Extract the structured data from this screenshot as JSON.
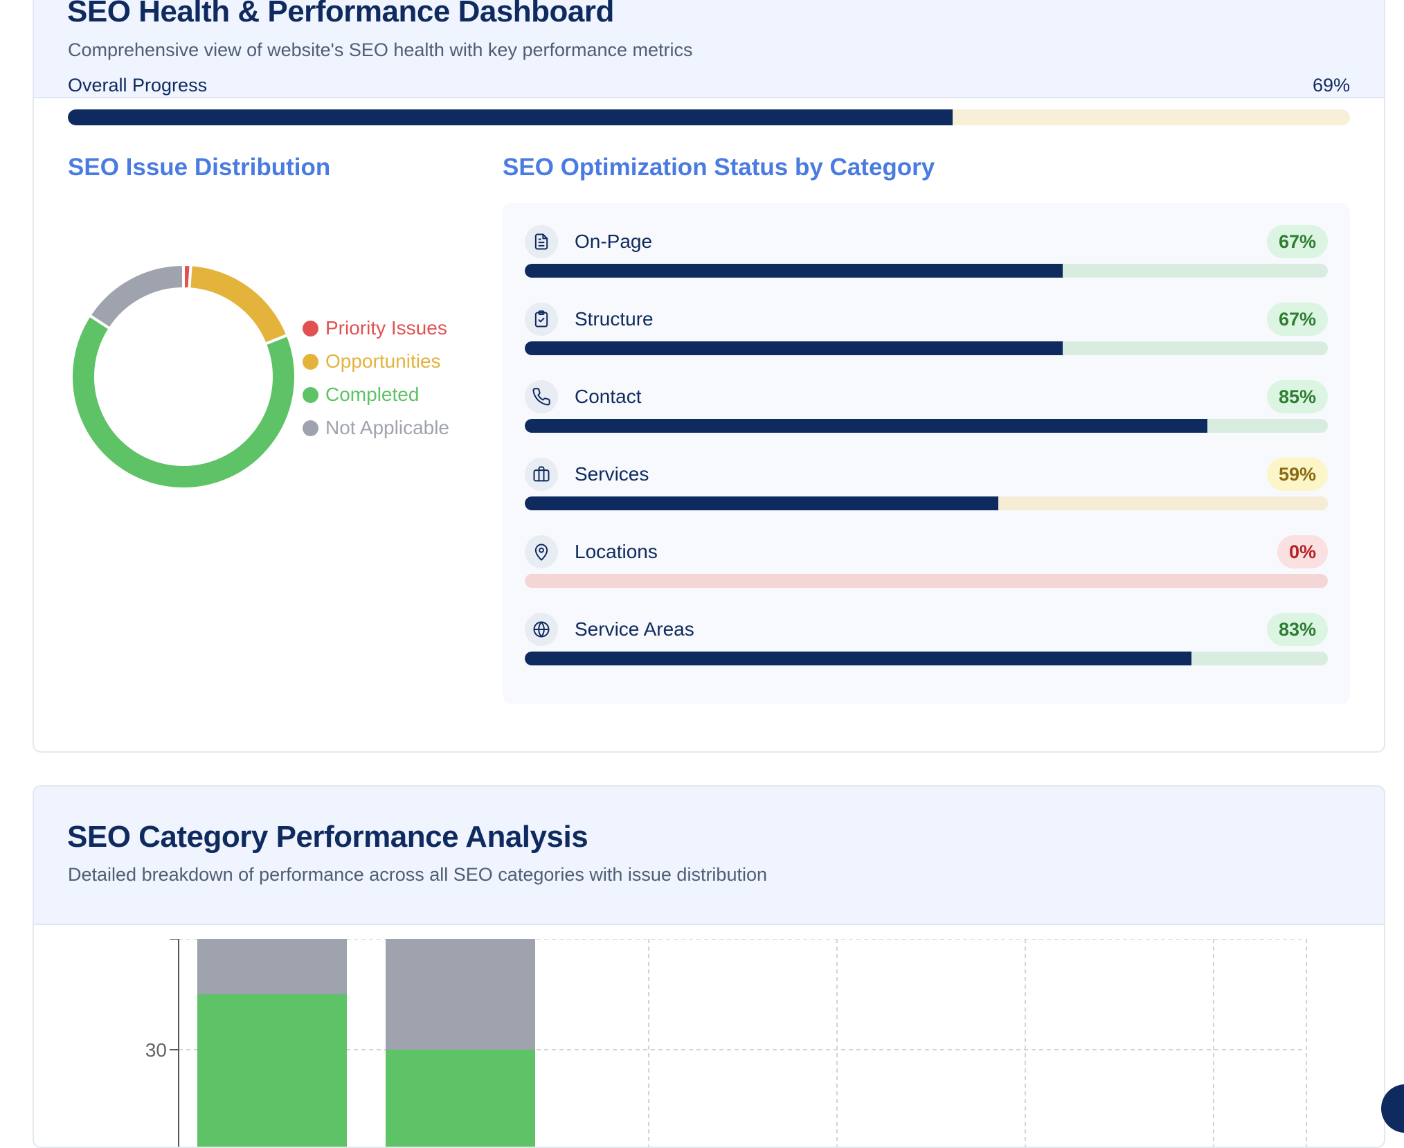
{
  "dashboard": {
    "title": "SEO Health & Performance Dashboard",
    "subtitle": "Comprehensive view of website's SEO health with key performance metrics",
    "overall": {
      "label": "Overall Progress",
      "value_text": "69%",
      "value": 69
    }
  },
  "distribution": {
    "title": "SEO Issue Distribution",
    "legend": [
      {
        "label": "Priority Issues",
        "color": "#e05252"
      },
      {
        "label": "Opportunities",
        "color": "#e3b33c"
      },
      {
        "label": "Completed",
        "color": "#5ec266"
      },
      {
        "label": "Not Applicable",
        "color": "#9ea3ad"
      }
    ]
  },
  "status": {
    "title": "SEO Optimization Status by Category",
    "categories": [
      {
        "label": "On-Page",
        "pct_text": "67%",
        "pct": 67,
        "icon": "document-icon",
        "tone": "green"
      },
      {
        "label": "Structure",
        "pct_text": "67%",
        "pct": 67,
        "icon": "clipboard-check-icon",
        "tone": "green"
      },
      {
        "label": "Contact",
        "pct_text": "85%",
        "pct": 85,
        "icon": "phone-icon",
        "tone": "green"
      },
      {
        "label": "Services",
        "pct_text": "59%",
        "pct": 59,
        "icon": "briefcase-icon",
        "tone": "yellow"
      },
      {
        "label": "Locations",
        "pct_text": "0%",
        "pct": 0,
        "icon": "map-pin-icon",
        "tone": "red"
      },
      {
        "label": "Service Areas",
        "pct_text": "83%",
        "pct": 83,
        "icon": "globe-icon",
        "tone": "green"
      }
    ]
  },
  "analysis": {
    "title": "SEO Category Performance Analysis",
    "subtitle": "Detailed breakdown of performance across all SEO categories with issue distribution"
  },
  "chart_data": [
    {
      "type": "pie",
      "title": "SEO Issue Distribution",
      "categories": [
        "Priority Issues",
        "Opportunities",
        "Completed",
        "Not Applicable"
      ],
      "values": [
        1,
        17,
        62,
        15
      ],
      "colors": [
        "#e05252",
        "#e3b33c",
        "#5ec266",
        "#9ea3ad"
      ]
    },
    {
      "type": "bar",
      "stacked": true,
      "categories": [
        "",
        ""
      ],
      "series": [
        {
          "values": [
            35,
            30
          ],
          "color": "#5ec266"
        },
        {
          "values": [
            5,
            11
          ],
          "color": "#9ea3ad"
        }
      ],
      "yticks": [
        "30"
      ],
      "grid": true
    }
  ]
}
